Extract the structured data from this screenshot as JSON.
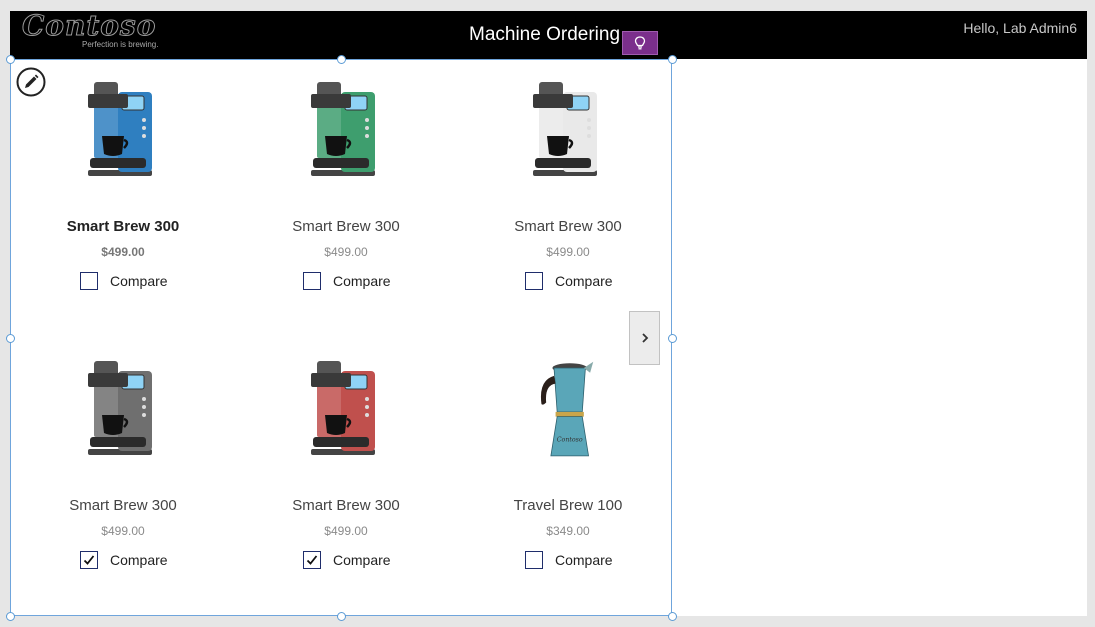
{
  "header": {
    "brand": "Contoso",
    "tagline": "Perfection is brewing.",
    "title": "Machine Ordering",
    "greeting": "Hello, Lab Admin6"
  },
  "gallery": {
    "compare_label": "Compare",
    "items": [
      {
        "name": "Smart Brew 300",
        "price": "$499.00",
        "compare_checked": false,
        "selected": true,
        "image": "coffee-machine-blue",
        "accent": "#2f7fc0"
      },
      {
        "name": "Smart Brew 300",
        "price": "$499.00",
        "compare_checked": false,
        "selected": false,
        "image": "coffee-machine-green",
        "accent": "#3e9e6e"
      },
      {
        "name": "Smart Brew 300",
        "price": "$499.00",
        "compare_checked": false,
        "selected": false,
        "image": "coffee-machine-white",
        "accent": "#e9e9e9"
      },
      {
        "name": "Smart Brew 300",
        "price": "$499.00",
        "compare_checked": true,
        "selected": false,
        "image": "coffee-machine-gray",
        "accent": "#6f6f6f"
      },
      {
        "name": "Smart Brew 300",
        "price": "$499.00",
        "compare_checked": true,
        "selected": false,
        "image": "coffee-machine-red",
        "accent": "#c0504d"
      },
      {
        "name": "Travel Brew 100",
        "price": "$349.00",
        "compare_checked": false,
        "selected": false,
        "image": "moka-pot",
        "accent": "#5aa6b8"
      }
    ]
  },
  "colors": {
    "header_bg": "#000000",
    "selection": "#6fa5dc",
    "idea_button": "#7b2f8c"
  }
}
